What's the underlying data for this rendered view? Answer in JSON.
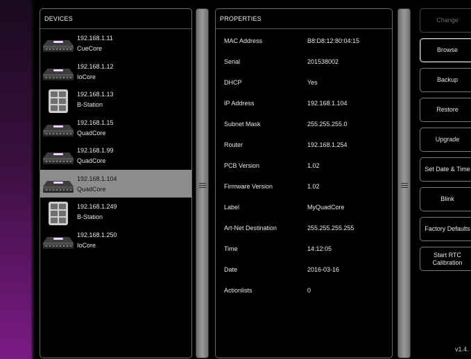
{
  "devices_panel": {
    "title": "DEVICES",
    "items": [
      {
        "ip": "192.168.1.11",
        "type": "CueCore",
        "icon": "core-device-icon"
      },
      {
        "ip": "192.168.1.12",
        "type": "IoCore",
        "icon": "core-device-icon"
      },
      {
        "ip": "192.168.1.13",
        "type": "B-Station",
        "icon": "b-station-icon"
      },
      {
        "ip": "192.168.1.15",
        "type": "QuadCore",
        "icon": "core-device-icon"
      },
      {
        "ip": "192.168.1.99",
        "type": "QuadCore",
        "icon": "core-device-icon"
      },
      {
        "ip": "192.168.1.104",
        "type": "QuadCore",
        "icon": "core-device-icon",
        "selected": true
      },
      {
        "ip": "192.168.1.249",
        "type": "B-Station",
        "icon": "b-station-icon"
      },
      {
        "ip": "192.168.1.250",
        "type": "IoCore",
        "icon": "core-device-icon"
      }
    ]
  },
  "properties_panel": {
    "title": "PROPERTIES",
    "rows": [
      {
        "label": "MAC Address",
        "value": "B8:D8:12:80:04:15"
      },
      {
        "label": "Serial",
        "value": "201538002"
      },
      {
        "label": "DHCP",
        "value": "Yes"
      },
      {
        "label": "IP Address",
        "value": "192.168.1.104"
      },
      {
        "label": "Subnet Mask",
        "value": "255.255.255.0"
      },
      {
        "label": "Router",
        "value": "192.168.1.254"
      },
      {
        "label": "PCB Version",
        "value": "1.02"
      },
      {
        "label": "Firmware Version",
        "value": "1.02"
      },
      {
        "label": "Label",
        "value": "MyQuadCore"
      },
      {
        "label": "Art-Net Destination",
        "value": "255.255.255.255"
      },
      {
        "label": "Time",
        "value": "14:12:05"
      },
      {
        "label": "Date",
        "value": "2016-03-16"
      },
      {
        "label": "Actionlists",
        "value": "0"
      }
    ]
  },
  "actions": {
    "change": "Change",
    "browse": "Browse",
    "backup": "Backup",
    "restore": "Restore",
    "upgrade": "Upgrade",
    "set_date_time": "Set Date & Time",
    "blink": "Blink",
    "factory_defaults": "Factory Defaults",
    "start_rtc_line1": "Start RTC",
    "start_rtc_line2": "Calibration"
  },
  "version": "v1.4.",
  "colors": {
    "selected_row": "#8d8d8d",
    "edge_accent": "#7b1b86"
  }
}
